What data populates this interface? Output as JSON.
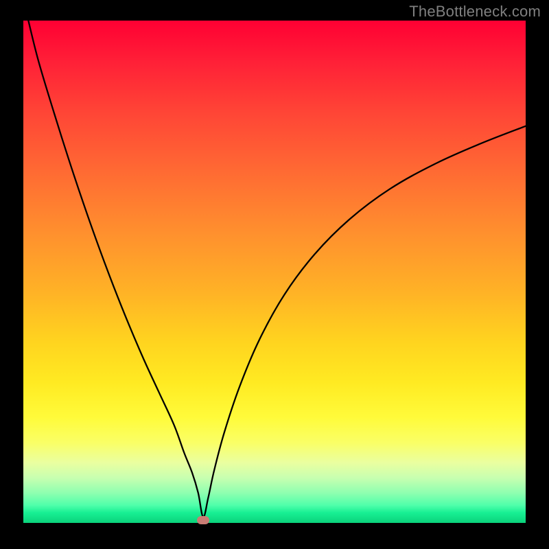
{
  "watermark": "TheBottleneck.com",
  "chart_data": {
    "type": "line",
    "title": "",
    "xlabel": "",
    "ylabel": "",
    "xlim": [
      0,
      100
    ],
    "ylim": [
      0,
      100
    ],
    "grid": false,
    "legend": false,
    "annotations": [],
    "marker": {
      "x": 35.8,
      "y": 0.6
    },
    "series": [
      {
        "name": "bottleneck-curve",
        "x": [
          1.0,
          3.0,
          6.0,
          9.0,
          12.0,
          15.0,
          18.0,
          21.0,
          24.0,
          27.0,
          30.0,
          32.0,
          33.6,
          34.8,
          35.8,
          36.8,
          38.0,
          40.0,
          43.0,
          47.0,
          52.0,
          58.0,
          65.0,
          73.0,
          82.0,
          91.0,
          100.0
        ],
        "y": [
          100.0,
          92.0,
          82.0,
          72.5,
          63.5,
          55.0,
          47.0,
          39.5,
          32.5,
          26.0,
          19.5,
          14.0,
          10.0,
          6.0,
          1.2,
          5.0,
          10.5,
          18.0,
          27.0,
          36.5,
          45.5,
          53.5,
          60.5,
          66.5,
          71.5,
          75.5,
          79.0
        ]
      }
    ],
    "gradient": {
      "orientation": "vertical",
      "stops": [
        {
          "pos": 0.0,
          "color": "#ff0033"
        },
        {
          "pos": 0.3,
          "color": "#ff6a33"
        },
        {
          "pos": 0.64,
          "color": "#ffd41f"
        },
        {
          "pos": 0.84,
          "color": "#faff66"
        },
        {
          "pos": 0.96,
          "color": "#4fffaa"
        },
        {
          "pos": 1.0,
          "color": "#0bd27b"
        }
      ]
    }
  }
}
